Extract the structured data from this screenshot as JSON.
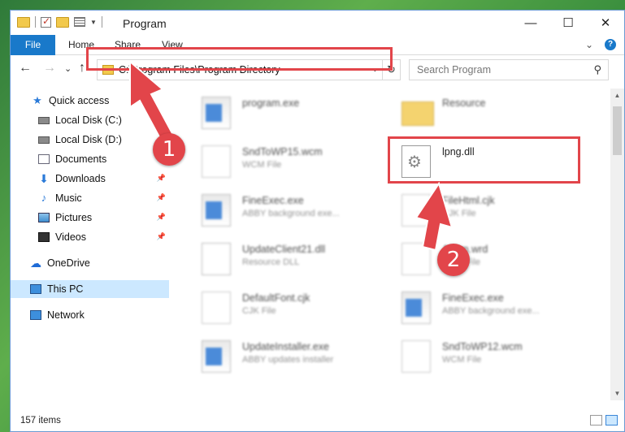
{
  "titlebar": {
    "title": "Program",
    "minimize": "—",
    "maximize": "☐",
    "close": "✕"
  },
  "ribbon": {
    "tabs": [
      "File",
      "Home",
      "Share",
      "View"
    ],
    "expand": "⌄",
    "help": "?"
  },
  "nav": {
    "back": "←",
    "forward": "→",
    "recent": "⌄",
    "up": "↑",
    "address": "C:\\Program Files\\Program Directory",
    "address_dropdown": "⌄",
    "refresh": "↻",
    "search_placeholder": "Search Program",
    "search_icon": "⚲"
  },
  "sidebar": {
    "items": [
      {
        "label": "Quick access",
        "icon": "star-icon"
      },
      {
        "label": "Local Disk (C:)",
        "icon": "drive-icon"
      },
      {
        "label": "Local Disk (D:)",
        "icon": "drive-icon"
      },
      {
        "label": "Documents",
        "icon": "documents-icon"
      },
      {
        "label": "Downloads",
        "icon": "download-icon"
      },
      {
        "label": "Music",
        "icon": "music-icon"
      },
      {
        "label": "Pictures",
        "icon": "pictures-icon"
      },
      {
        "label": "Videos",
        "icon": "videos-icon"
      },
      {
        "label": "OneDrive",
        "icon": "cloud-icon"
      },
      {
        "label": "This PC",
        "icon": "computer-icon"
      },
      {
        "label": "Network",
        "icon": "network-icon"
      }
    ]
  },
  "files": [
    {
      "name": "program.exe",
      "type": ""
    },
    {
      "name": "Resource",
      "type": ""
    },
    {
      "name": "SndToWP15.wcm",
      "type": "WCM File"
    },
    {
      "name": "lpng.dll",
      "type": ""
    },
    {
      "name": "FineExec.exe",
      "type": "ABBY background exe..."
    },
    {
      "name": "FileHtml.cjk",
      "type": "CJK File"
    },
    {
      "name": "UpdateClient21.dll",
      "type": "Resource DLL"
    },
    {
      "name": "Acorn.wrd",
      "type": "WRD File"
    },
    {
      "name": "DefaultFont.cjk",
      "type": "CJK File"
    },
    {
      "name": "FineExec.exe",
      "type": "ABBY background exe..."
    },
    {
      "name": "UpdateInstaller.exe",
      "type": "ABBY updates installer"
    },
    {
      "name": "SndToWP12.wcm",
      "type": "WCM File"
    }
  ],
  "status": {
    "count": "157 items"
  },
  "annotations": {
    "step1": "1",
    "step2": "2",
    "color": "#e2454a"
  }
}
